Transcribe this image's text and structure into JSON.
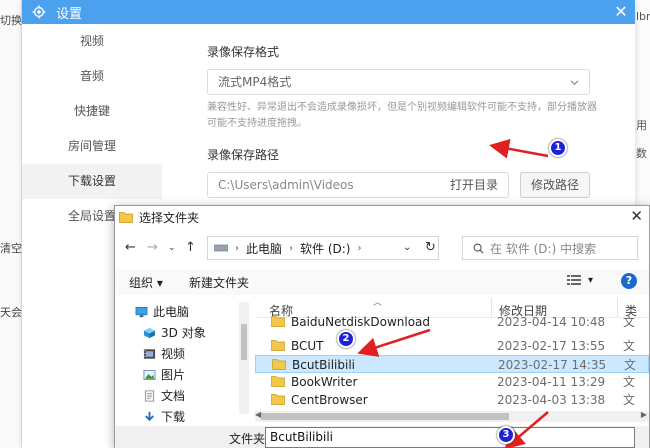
{
  "background_left": {
    "texts": [
      "切换",
      "清空",
      "天会"
    ]
  },
  "background_right": {
    "texts": [
      "lbn&",
      "用",
      "数"
    ]
  },
  "settings": {
    "title": "设置",
    "nav": [
      "视频",
      "音频",
      "快捷键",
      "房间管理",
      "下载设置",
      "全局设置"
    ],
    "active_nav": "下载设置",
    "format_label": "录像保存格式",
    "format_value": "流式MP4格式",
    "format_hint": "兼容性好、异常退出不会造成录像损坏，但是个别视频编辑软件可能不支持，部分播放器可能不支持进度拖拽。",
    "path_label": "录像保存路径",
    "path_value": "C:\\Users\\admin\\Videos",
    "open_dir_label": "打开目录",
    "change_path_label": "修改路径"
  },
  "chooser": {
    "title": "选择文件夹",
    "breadcrumb": [
      "此电脑",
      "软件 (D:)"
    ],
    "search_placeholder": "在 软件 (D:) 中搜索",
    "organize_label": "组织 ▾",
    "new_folder_label": "新建文件夹",
    "view_label": "▾",
    "help_label": "?",
    "tree": [
      {
        "label": "此电脑",
        "icon": "computer-icon"
      },
      {
        "label": "3D 对象",
        "icon": "cube-icon"
      },
      {
        "label": "视频",
        "icon": "video-icon"
      },
      {
        "label": "图片",
        "icon": "picture-icon"
      },
      {
        "label": "文档",
        "icon": "document-icon"
      },
      {
        "label": "下载",
        "icon": "download-icon"
      }
    ],
    "columns": {
      "name": "名称",
      "date": "修改日期",
      "type": "类"
    },
    "files": [
      {
        "name": "BaiduNetdiskDownload",
        "date": "2023-04-14 10:48",
        "type": "文"
      },
      {
        "name": "BCUT",
        "date": "2023-02-17 13:55",
        "type": "文"
      },
      {
        "name": "BcutBilibili",
        "date": "2023-02-17 14:35",
        "type": "文",
        "selected": true
      },
      {
        "name": "BookWriter",
        "date": "2023-04-11 13:29",
        "type": "文"
      },
      {
        "name": "CentBrowser",
        "date": "2023-04-03 13:38",
        "type": "文"
      }
    ],
    "filename_label": "文件夹:",
    "filename_value": "BcutBilibili"
  },
  "markers": [
    "1",
    "2",
    "3"
  ],
  "colors": {
    "title_bar": "#4ba1ee",
    "marker": "#1e21d6",
    "arrow": "#e02020",
    "selection": "#cce8ff",
    "folder": "#f3c74a"
  }
}
